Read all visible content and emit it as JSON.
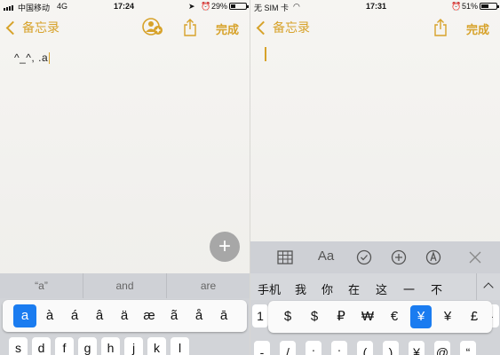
{
  "left": {
    "status": {
      "carrier": "中国移动",
      "network": "4G",
      "time": "17:24",
      "battery": "29%",
      "battery_level": 0.29
    },
    "nav": {
      "back_label": "备忘录",
      "done_label": "完成"
    },
    "note": {
      "text": "^_^, .a"
    },
    "plus_label": "+",
    "suggestions": [
      "“a”",
      "and",
      "are"
    ],
    "accent_keys": [
      "a",
      "à",
      "á",
      "â",
      "ä",
      "æ",
      "ã",
      "å",
      "ā"
    ],
    "selected_accent": 0,
    "bottom_keys": [
      "s",
      "d",
      "f",
      "g",
      "h",
      "j",
      "k",
      "l"
    ]
  },
  "right": {
    "status": {
      "carrier": "无 SIM 卡",
      "time": "17:31",
      "battery": "51%",
      "battery_level": 0.51
    },
    "nav": {
      "back_label": "备忘录",
      "done_label": "完成"
    },
    "toolbar_icons": [
      "table-icon",
      "text-format-icon",
      "checklist-icon",
      "add-icon",
      "sketch-icon",
      "close-icon"
    ],
    "toolbar_aa": "Aa",
    "candidates": [
      "手机",
      "我",
      "你",
      "在",
      "这",
      "一",
      "不"
    ],
    "currency_keys": [
      "$",
      "$",
      "₽",
      "₩",
      "€",
      "¥",
      "¥",
      "£"
    ],
    "selected_currency": 5,
    "bg_keys": {
      "left_top": "1",
      "left_bottom": "-",
      "bottom": [
        "-",
        "/",
        ":",
        ";",
        "(",
        ")",
        "¥",
        "@",
        "“"
      ]
    }
  }
}
